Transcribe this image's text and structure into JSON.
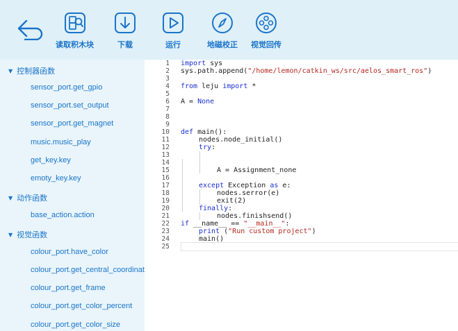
{
  "toolbar": {
    "read_blocks_label": "读取积木块",
    "download_label": "下载",
    "run_label": "运行",
    "geomagnetic_label": "地磁校正",
    "video_label": "视觉回传"
  },
  "sidebar": {
    "categories": [
      {
        "label": "控制器函数",
        "items": [
          "sensor_port.get_gpio",
          "sensor_port.set_output",
          "sensor_port.get_magnet",
          "music.music_play",
          "get_key.key",
          "emoty_key.key"
        ]
      },
      {
        "label": "动作函数",
        "items": [
          "base_action.action"
        ]
      },
      {
        "label": "视觉函数",
        "items": [
          "colour_port.have_color",
          "colour_port.get_central_coordinat",
          "colour_port.get_frame",
          "colour_port.get_color_percent",
          "colour_port.get_color_size"
        ]
      }
    ]
  },
  "editor": {
    "line_numbers": [
      "1",
      "2",
      "3",
      "4",
      "5",
      "6",
      "7",
      "8",
      "9",
      "10",
      "11",
      "12",
      "13",
      "14",
      "15",
      "16",
      "17",
      "18",
      "19",
      "20",
      "21",
      "22",
      "23",
      "24",
      "25"
    ],
    "code": {
      "l1": [
        "import",
        " sys"
      ],
      "l2": [
        "sys.path.append(",
        "\"/home/lemon/catkin_ws/src/aelos_smart_ros\"",
        ")"
      ],
      "l4": [
        "from",
        " leju ",
        "import",
        " *"
      ],
      "l6": [
        "A = ",
        "None"
      ],
      "l10": [
        "def",
        " main():"
      ],
      "l11": [
        "nodes.node_initial()"
      ],
      "l12": [
        "try",
        ":"
      ],
      "l15": [
        "A = Assignment_none"
      ],
      "l17": [
        "except",
        " Exception ",
        "as",
        " e:"
      ],
      "l18": [
        "nodes.serror(e)"
      ],
      "l19": [
        "exit(2)"
      ],
      "l20": [
        "finally",
        ":"
      ],
      "l21": [
        "nodes.finishsend()"
      ],
      "l22": [
        "if",
        " __name__ == ",
        "\"__main__\"",
        ":"
      ],
      "l23": [
        "print",
        " (",
        "\"Run custom project\"",
        ")"
      ],
      "l24": [
        "main()"
      ]
    }
  },
  "colors": {
    "toolbar_bg": "#dff0f8",
    "sidebar_bg": "#e9f5fb",
    "accent": "#1a74c9",
    "keyword": "#1a2fcf",
    "string": "#b3261e"
  }
}
